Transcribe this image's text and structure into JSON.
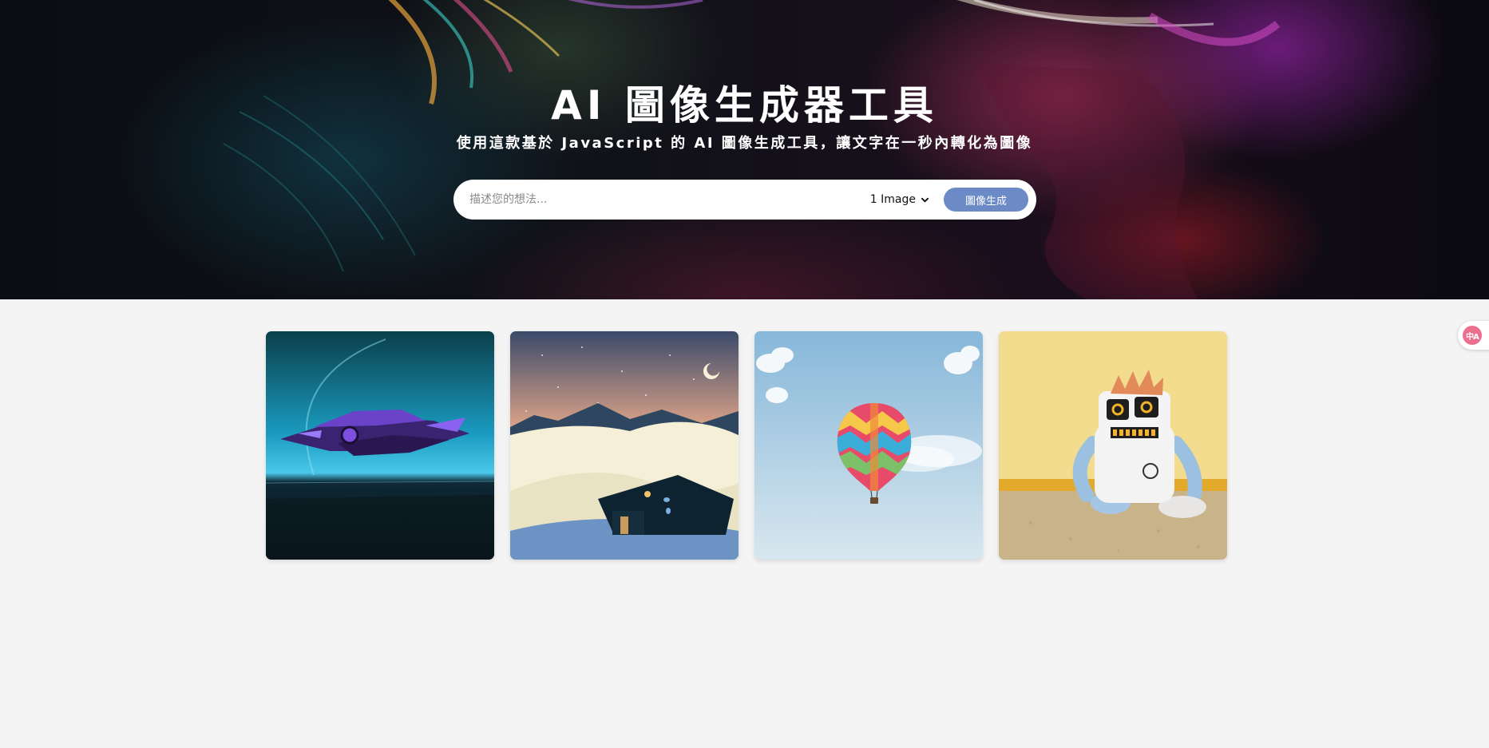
{
  "hero": {
    "title": "AI 圖像生成器工具",
    "subtitle": "使用這款基於 JavaScript 的 AI 圖像生成工具，讓文字在一秒內轉化為圖像"
  },
  "search": {
    "placeholder": "描述您的想法...",
    "value": "",
    "count_selected": "1 Image",
    "generate_label": "圖像生成"
  },
  "gallery": {
    "images": [
      {
        "subject": "purple spaceship over blue planet"
      },
      {
        "subject": "snowy cabin under night sky"
      },
      {
        "subject": "hot air balloon in blue sky"
      },
      {
        "subject": "plush robot sitting against yellow wall"
      }
    ]
  },
  "translate_widget": {
    "icon": "translate-icon",
    "color": "#ec6f8e"
  },
  "colors": {
    "accent": "#6b8ac6",
    "page_background": "#f4f4f4"
  }
}
